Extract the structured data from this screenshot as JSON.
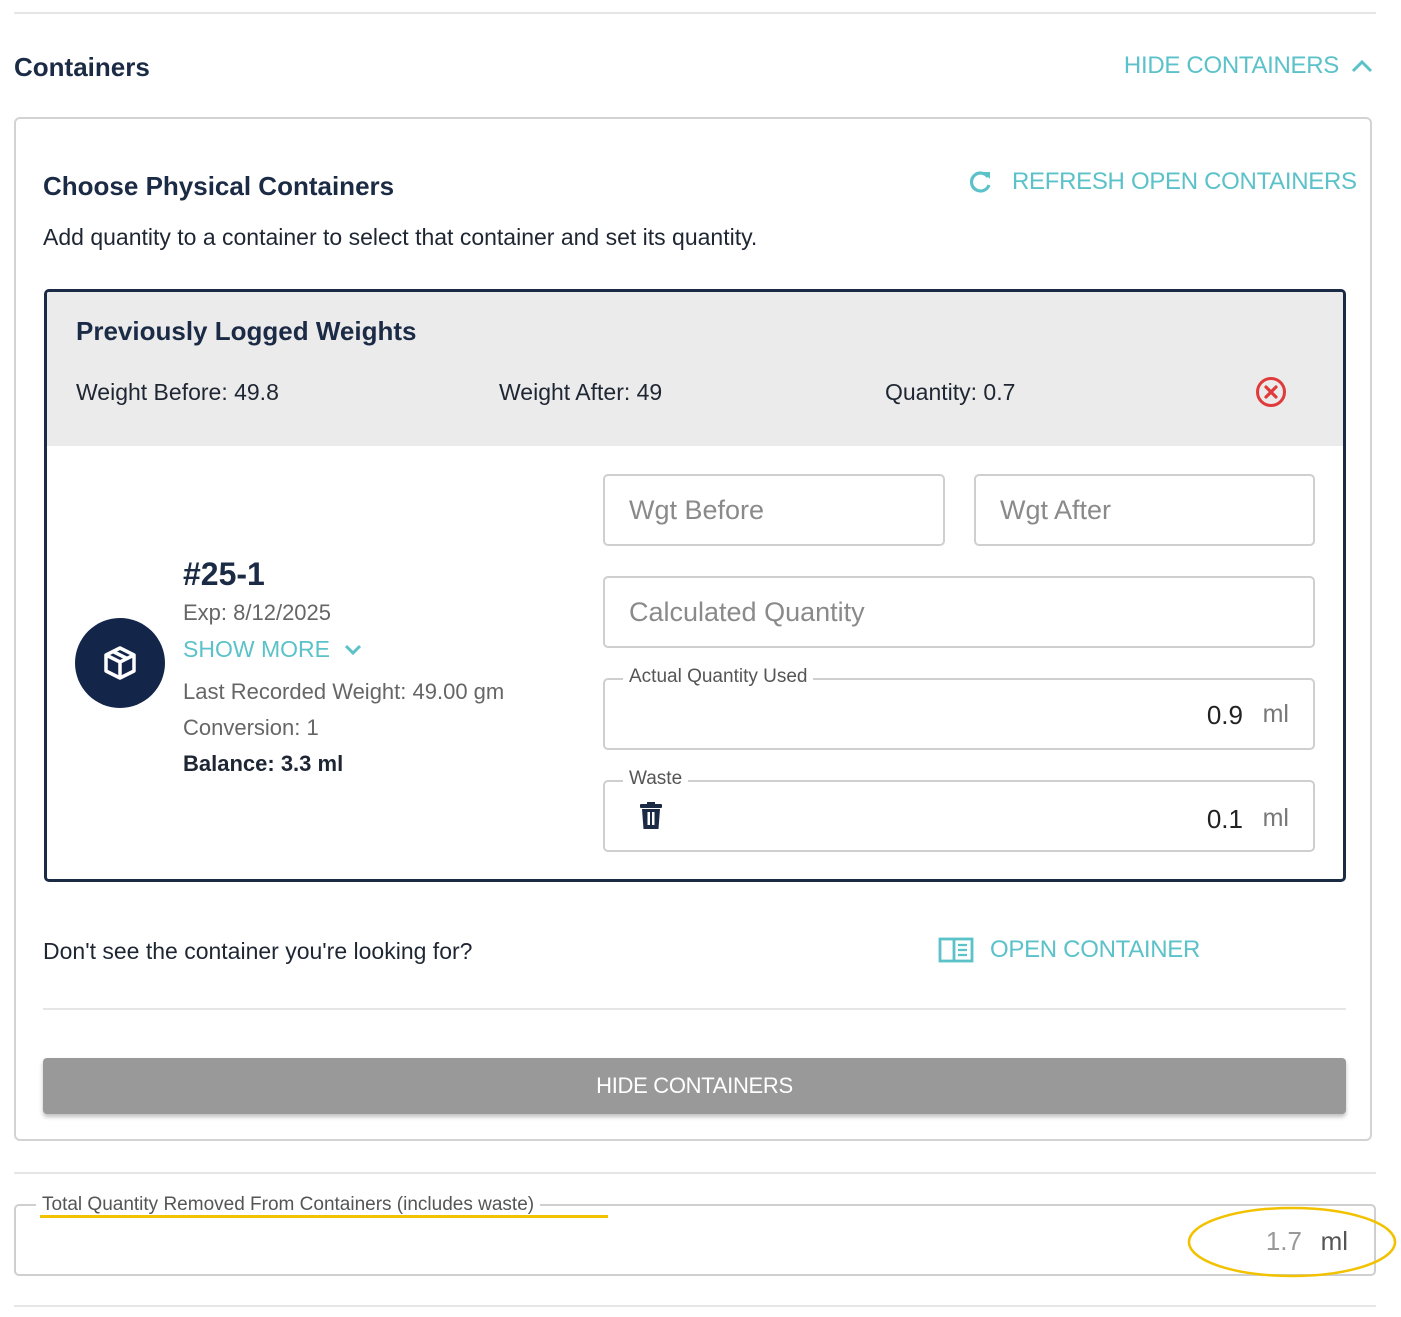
{
  "section": {
    "title": "Containers",
    "toggle_label": "HIDE CONTAINERS"
  },
  "chooser": {
    "title": "Choose Physical Containers",
    "refresh_label": "REFRESH OPEN CONTAINERS",
    "helper_text": "Add quantity to a container to select that container and set its quantity."
  },
  "previous": {
    "title": "Previously Logged Weights",
    "weight_before": "Weight Before: 49.8",
    "weight_after": "Weight After: 49",
    "quantity": "Quantity: 0.7"
  },
  "container": {
    "id": "#25-1",
    "exp": "Exp: 8/12/2025",
    "show_more": "SHOW MORE",
    "last_weight": "Last Recorded Weight: 49.00 gm",
    "conversion": "Conversion: 1",
    "balance": "Balance: 3.3 ml"
  },
  "inputs": {
    "wgt_before_placeholder": "Wgt Before",
    "wgt_after_placeholder": "Wgt After",
    "calc_qty_placeholder": "Calculated Quantity",
    "actual_label": "Actual Quantity Used",
    "actual_value": "0.9",
    "actual_unit": "ml",
    "waste_label": "Waste",
    "waste_value": "0.1",
    "waste_unit": "ml"
  },
  "footer": {
    "question": "Don't see the container you're looking for?",
    "open_container": "OPEN CONTAINER",
    "hide_button": "HIDE CONTAINERS"
  },
  "total": {
    "label": "Total Quantity Removed From Containers (includes waste)",
    "value": "1.7",
    "unit": "ml"
  },
  "colors": {
    "accent": "#5bc2c9",
    "navy": "#1c2b45",
    "danger": "#e03a3a",
    "highlight": "#f2c200",
    "button_gray": "#999999"
  }
}
